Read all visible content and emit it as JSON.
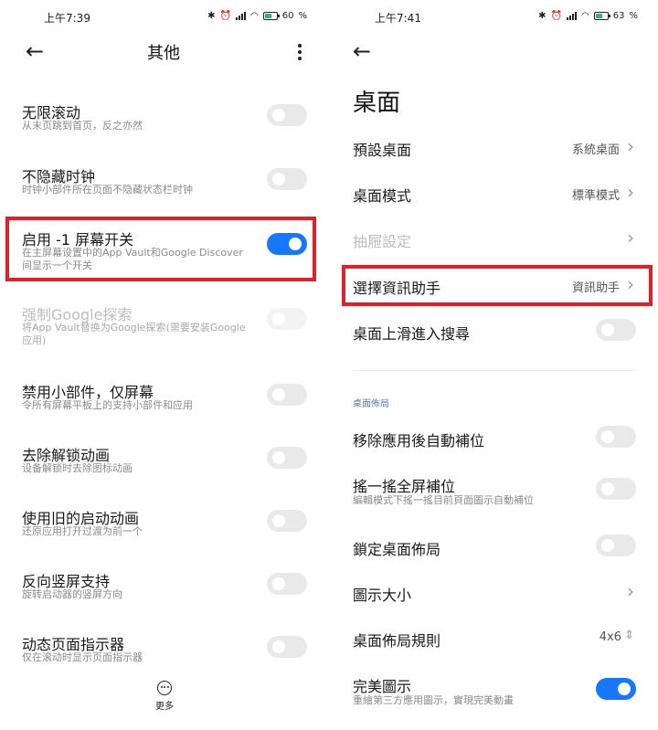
{
  "left": {
    "status": {
      "time": "上午7:39",
      "battery": "60",
      "battery_fraction": 0.6
    },
    "title": "其他",
    "items": [
      {
        "label": "无限滚动",
        "sub": [
          "从末页跳到首页，反之亦然"
        ],
        "on": false
      },
      {
        "label": "不隐藏时钟",
        "sub": [
          "时钟小部件所在页面不隐藏状态栏时钟"
        ],
        "on": false
      },
      {
        "label": "启用 -1 屏幕开关",
        "sub": [
          "在主屏幕设置中的App Vault和Google Discover",
          "间显示一个开关"
        ],
        "on": true
      },
      {
        "label": "强制Google探索",
        "sub": [
          "将App Vault替换为Google探索(需要安装Google",
          "应用)"
        ],
        "on": false,
        "disabled": true
      },
      {
        "label": "禁用小部件，仅屏幕",
        "sub": [
          "令所有屏幕平板上的支持小部件和应用"
        ],
        "on": false
      },
      {
        "label": "去除解锁动画",
        "sub": [
          "设备解锁时去除图标动画"
        ],
        "on": false
      },
      {
        "label": "使用旧的启动动画",
        "sub": [
          "还原应用打开过渡为前一个"
        ],
        "on": false
      },
      {
        "label": "反向竖屏支持",
        "sub": [
          "旋转启动器的竖屏方向"
        ],
        "on": false
      },
      {
        "label": "动态页面指示器",
        "sub": [
          "仅在滚动时显示页面指示器"
        ],
        "on": false
      }
    ],
    "more_label": "更多"
  },
  "right": {
    "status": {
      "time": "上午7:41",
      "battery": "63",
      "battery_fraction": 0.63
    },
    "title": "桌面",
    "top_items": [
      {
        "label": "預設桌面",
        "value": "系統桌面",
        "chevron": true
      },
      {
        "label": "桌面模式",
        "value": "標準模式",
        "chevron": true
      },
      {
        "label": "抽屜設定",
        "value": "",
        "chevron": true,
        "disabled": true
      },
      {
        "label": "選擇資訊助手",
        "value": "資訊助手",
        "chevron": true
      },
      {
        "label": "桌面上滑進入搜尋",
        "toggle": true,
        "on": false
      }
    ],
    "section_label": "桌面佈局",
    "layout_items": [
      {
        "label": "移除應用後自動補位",
        "toggle": true,
        "on": false
      },
      {
        "label": "搖一搖全屏補位",
        "sub": "編輯模式下搖一搖目前頁面圖示自動補位",
        "toggle": true,
        "on": false
      },
      {
        "label": "鎖定桌面佈局",
        "toggle": true,
        "on": false
      },
      {
        "label": "圖示大小",
        "chevron": true
      },
      {
        "label": "桌面佈局規則",
        "value": "4x6",
        "updown": true
      },
      {
        "label": "完美圖示",
        "sub": "重繪第三方應用圖示，實現完美動畫",
        "toggle": true,
        "on": true
      }
    ]
  },
  "colors": {
    "accent": "#1677ff",
    "highlight": "#e3202a"
  },
  "icons": {
    "back": "arrow-left-icon",
    "more": "kebab-icon",
    "chevron": "chevron-right-icon"
  }
}
